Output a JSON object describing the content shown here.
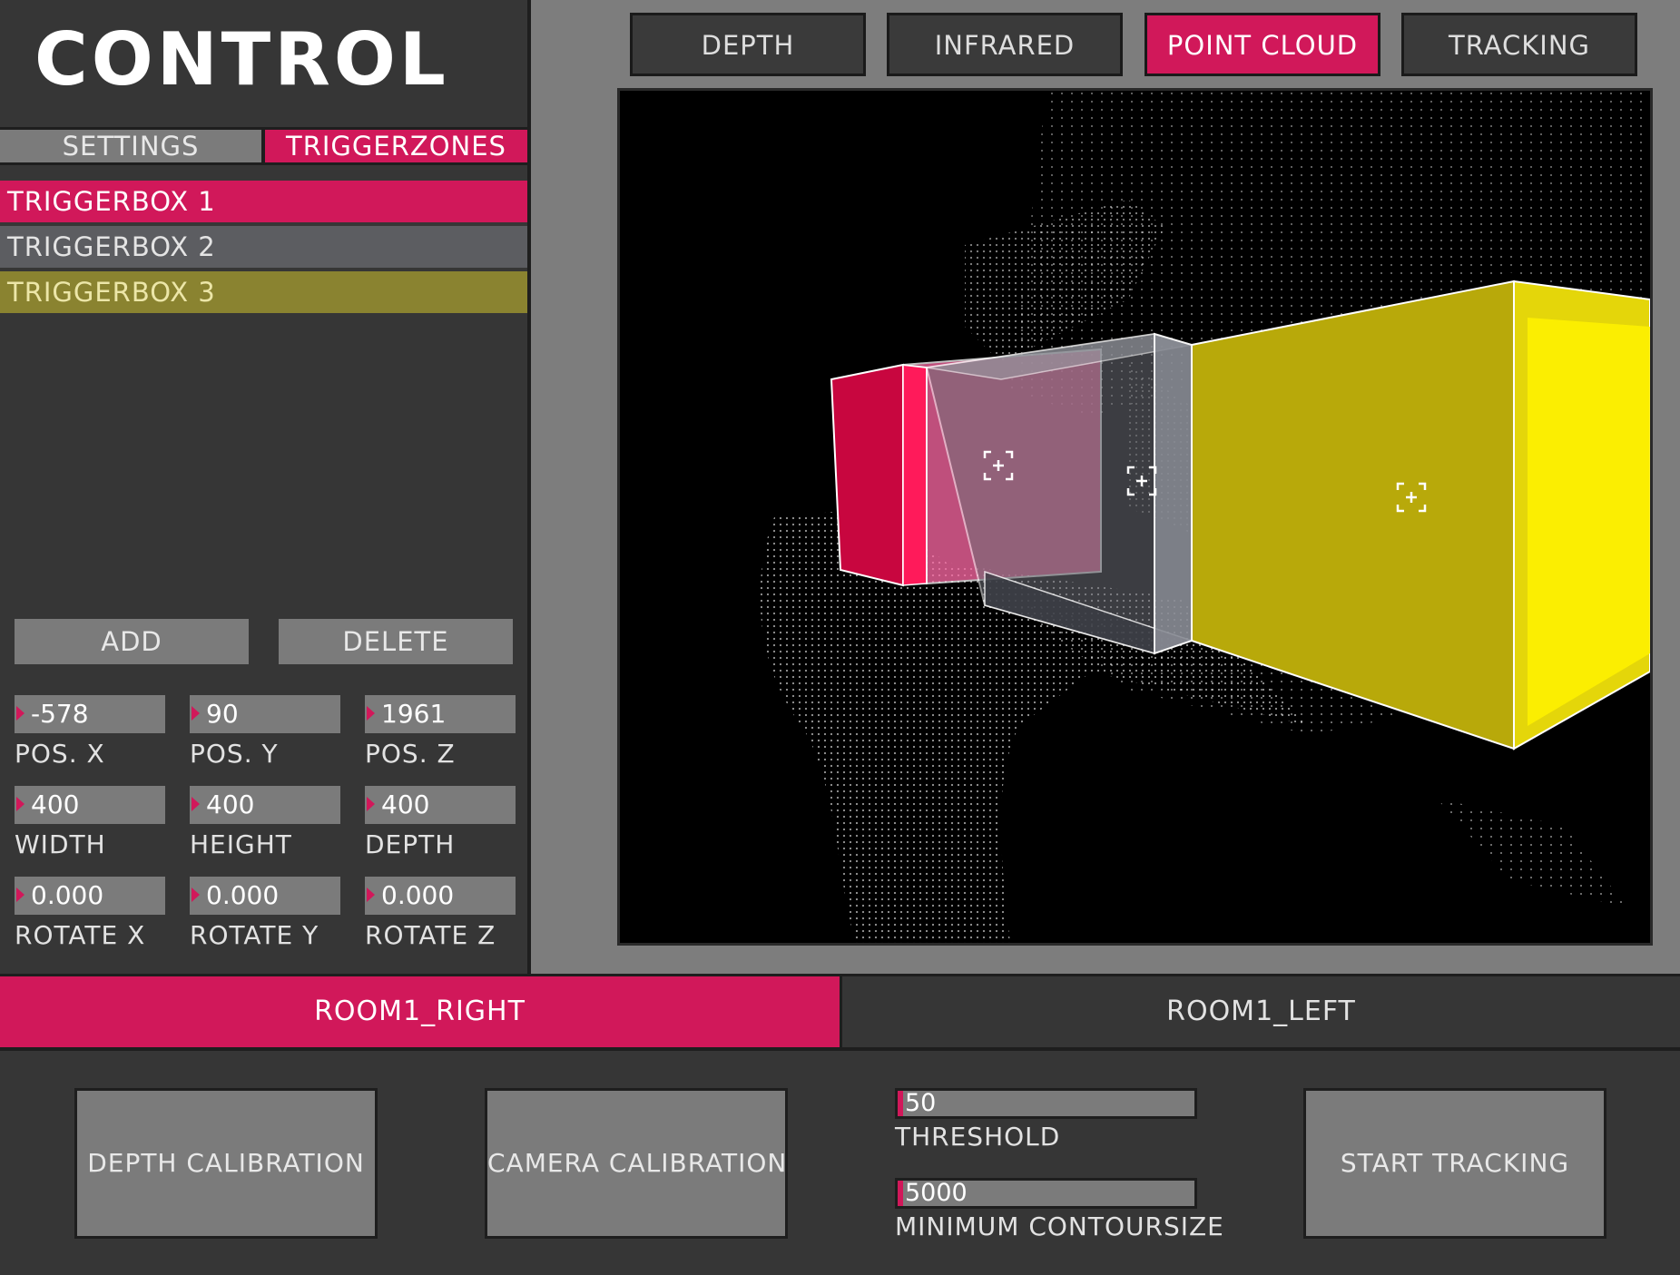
{
  "app": {
    "title": "CONTROL"
  },
  "panel_tabs": {
    "settings": "SETTINGS",
    "triggerzones": "TRIGGERZONES",
    "active": "triggerzones"
  },
  "trigger_boxes": [
    {
      "label": "TRIGGERBOX 1",
      "color": "#d1185a",
      "selected": true
    },
    {
      "label": "TRIGGERBOX 2",
      "color": "#5c5d61",
      "selected": false
    },
    {
      "label": "TRIGGERBOX 3",
      "color": "#8a8330",
      "selected": false
    }
  ],
  "actions": {
    "add": "ADD",
    "delete": "DELETE"
  },
  "fields": {
    "pos_x": {
      "value": "-578",
      "label": "POS. X"
    },
    "pos_y": {
      "value": "90",
      "label": "POS. Y"
    },
    "pos_z": {
      "value": "1961",
      "label": "POS. Z"
    },
    "width": {
      "value": "400",
      "label": "WIDTH"
    },
    "height": {
      "value": "400",
      "label": "HEIGHT"
    },
    "depth": {
      "value": "400",
      "label": "DEPTH"
    },
    "rotate_x": {
      "value": "0.000",
      "label": "ROTATE X"
    },
    "rotate_y": {
      "value": "0.000",
      "label": "ROTATE Y"
    },
    "rotate_z": {
      "value": "0.000",
      "label": "ROTATE Z"
    }
  },
  "view_tabs": {
    "depth": "DEPTH",
    "infrared": "INFRARED",
    "point_cloud": "POINT CLOUD",
    "tracking": "TRACKING",
    "active": "point_cloud"
  },
  "rooms": {
    "right": "ROOM1_RIGHT",
    "left": "ROOM1_LEFT",
    "active": "right"
  },
  "bottom": {
    "depth_calibration": "DEPTH CALIBRATION",
    "camera_calibration": "CAMERA CALIBRATION",
    "start_tracking": "START TRACKING",
    "threshold": {
      "value": "50",
      "label": "THRESHOLD"
    },
    "min_contour": {
      "value": "5000",
      "label": "MINIMUM CONTOURSIZE"
    }
  },
  "colors": {
    "accent": "#d1185a",
    "panel": "#363636",
    "control": "#7b7b7b",
    "yellow_box": "#b8a90a"
  },
  "icons": {
    "cube_handle": "crosshair-plus-icon"
  }
}
